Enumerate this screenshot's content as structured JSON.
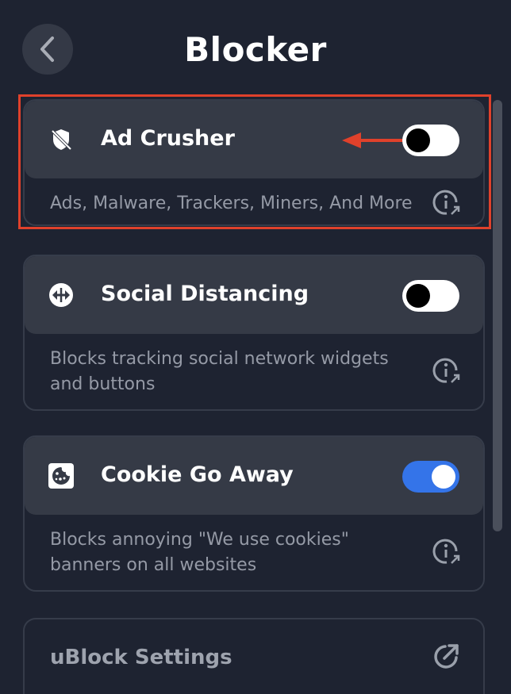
{
  "header": {
    "title": "Blocker",
    "back_icon": "chevron-left-icon"
  },
  "cards": [
    {
      "title": "Ad Crusher",
      "description": "Ads, Malware, Trackers, Miners, And More",
      "icon": "ad-crusher-icon",
      "enabled": false
    },
    {
      "title": "Social Distancing",
      "description": "Blocks tracking social network widgets and buttons",
      "icon": "social-distancing-icon",
      "enabled": false
    },
    {
      "title": "Cookie Go Away",
      "description": "Blocks annoying \"We use cookies\" banners on all websites",
      "icon": "cookie-icon",
      "enabled": true
    }
  ],
  "settings": {
    "label": "uBlock Settings",
    "icon": "external-link-icon"
  },
  "colors": {
    "background": "#1e2331",
    "card_header": "#353a46",
    "toggle_on": "#3474e9",
    "annotation": "#e0412b"
  }
}
